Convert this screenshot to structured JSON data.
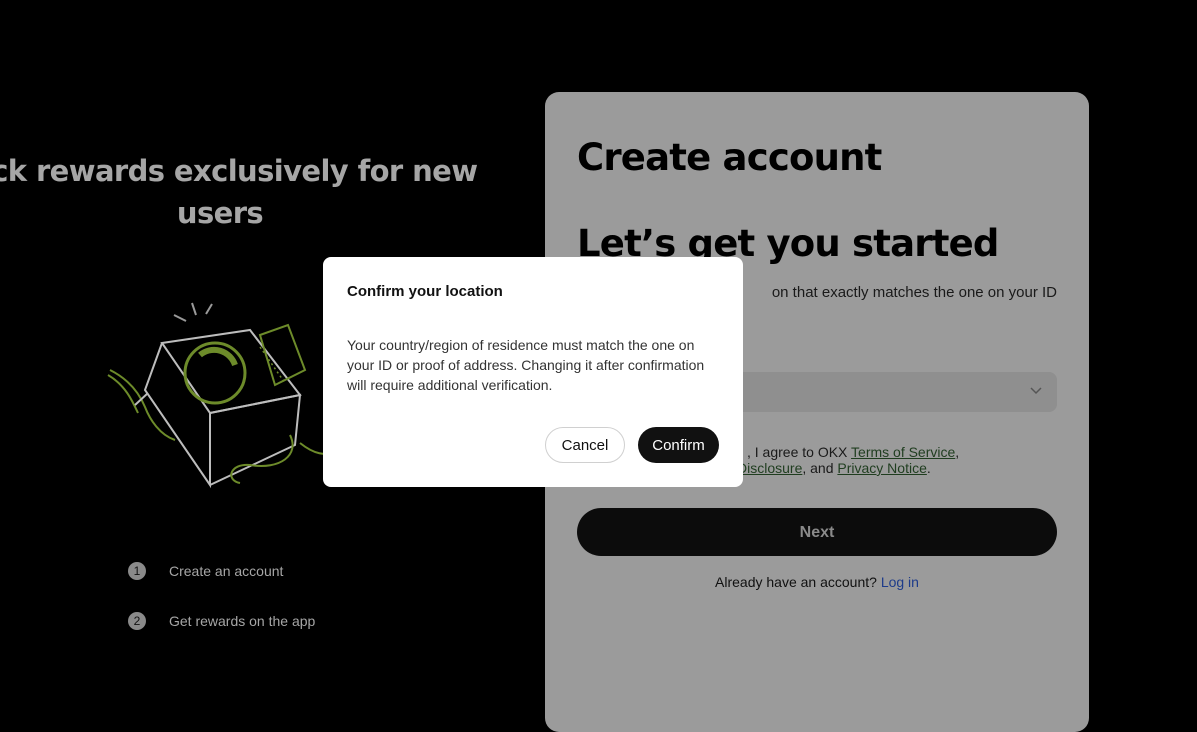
{
  "promo": {
    "title": "lock rewards exclusively for new users",
    "steps": [
      {
        "num": "1",
        "label": "Create an account"
      },
      {
        "num": "2",
        "label": "Get rewards on the app"
      }
    ]
  },
  "card": {
    "title": "Create account",
    "subtitle": "Let’s get you started",
    "description": "on that exactly matches the one on your ID",
    "region_select": {
      "value": "",
      "icon": "chevron-down-icon"
    },
    "agreement": {
      "prefix": ", I agree to OKX",
      "terms_link": "Terms of Service",
      "sep1": ",",
      "disclosure_link": "Disclosure",
      "sep2": ", and",
      "privacy_link": "Privacy Notice",
      "suffix": "."
    },
    "next_label": "Next",
    "login_prompt": "Already have an account?",
    "login_link": "Log in"
  },
  "modal": {
    "title": "Confirm your location",
    "body": "Your country/region of residence must match the one on your ID or proof of address. Changing it after confirmation will require additional verification.",
    "cancel_label": "Cancel",
    "confirm_label": "Confirm"
  },
  "colors": {
    "overlay_card": "#9b9b9b",
    "accent_illustration": "#6d8b2a",
    "link": "#1d3b8a"
  }
}
